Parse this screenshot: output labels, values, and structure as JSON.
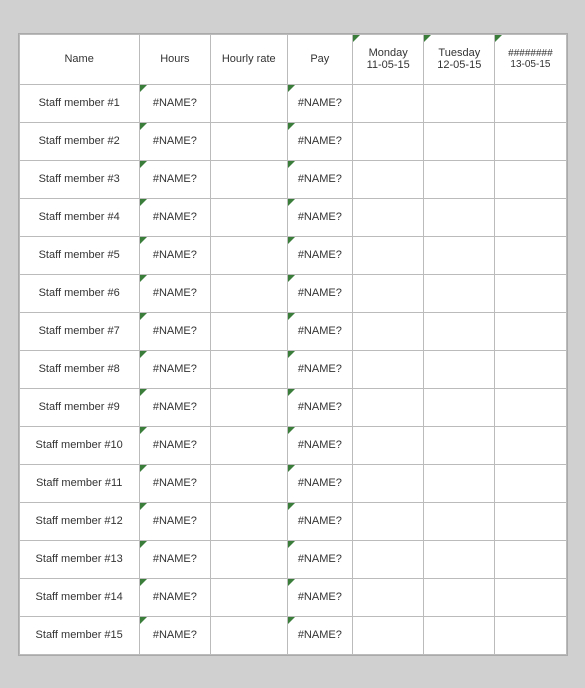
{
  "table": {
    "headers": [
      {
        "label": "Name",
        "class": "col-name"
      },
      {
        "label": "Hours",
        "class": "col-hours"
      },
      {
        "label": "Hourly rate",
        "class": "col-hourly"
      },
      {
        "label": "Pay",
        "class": "col-pay"
      },
      {
        "label": "Monday\n11-05-15",
        "class": "col-mon",
        "day": "Monday",
        "date": "11-05-15"
      },
      {
        "label": "Tuesday\n12-05-15",
        "class": "col-tue",
        "day": "Tuesday",
        "date": "12-05-15"
      },
      {
        "label": "########\n13-05-15",
        "class": "col-wed",
        "day": "########",
        "date": "13-05-15"
      }
    ],
    "rows": [
      {
        "name": "Staff member #1"
      },
      {
        "name": "Staff member #2"
      },
      {
        "name": "Staff member #3"
      },
      {
        "name": "Staff member #4"
      },
      {
        "name": "Staff member #5"
      },
      {
        "name": "Staff member #6"
      },
      {
        "name": "Staff member #7"
      },
      {
        "name": "Staff member #8"
      },
      {
        "name": "Staff member #9"
      },
      {
        "name": "Staff member #10"
      },
      {
        "name": "Staff member #11"
      },
      {
        "name": "Staff member #12"
      },
      {
        "name": "Staff member #13"
      },
      {
        "name": "Staff member #14"
      },
      {
        "name": "Staff member #15"
      }
    ],
    "error_value": "#NAME?",
    "hash_value": "########"
  }
}
